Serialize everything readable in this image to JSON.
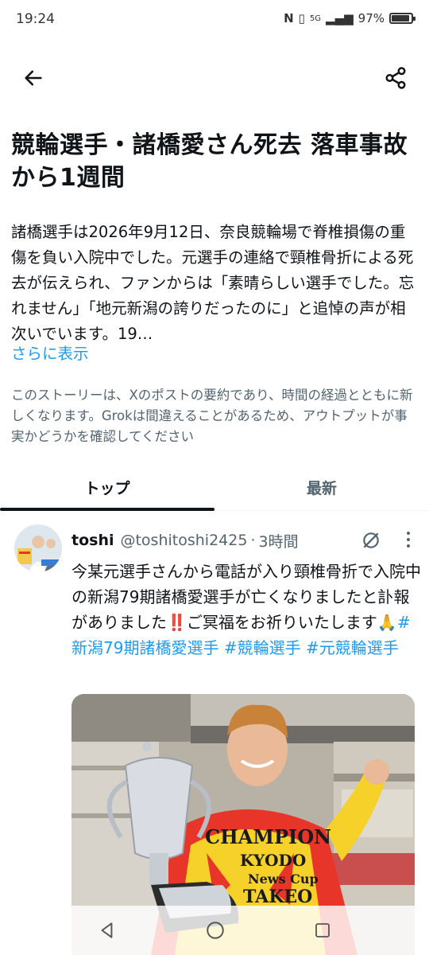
{
  "status_bar": {
    "time": "19:24",
    "network": "5G",
    "battery_text": "97%"
  },
  "nav": {
    "back_icon": "arrow-left-icon",
    "share_icon": "share-icon"
  },
  "story": {
    "title": "競輪選手・諸橋愛さん死去 落車事故から1週間",
    "body": "諸橋選手は2026年9月12日、奈良競輪場で脊椎損傷の重傷を負い入院中でした。元選手の連絡で頸椎骨折による死去が伝えられ、ファンからは「素晴らしい選手でした。忘れません」「地元新潟の誇りだったのに」と追悼の声が相次いでいます。19…",
    "show_more": "さらに表示",
    "disclaimer": "このストーリーは、Xのポストの要約であり、時間の経過とともに新しくなります。Grokは間違えることがあるため、アウトプットが事実かどうかを確認してください"
  },
  "tabs": [
    {
      "label": "トップ",
      "active": true
    },
    {
      "label": "最新",
      "active": false
    }
  ],
  "post": {
    "author": "toshi",
    "handle": "@toshitoshi2425",
    "separator": "·",
    "time": "3時間",
    "text": "今某元選手さんから電話が入り頸椎骨折で入院中の新潟79期諸橋愛選手が亡くなりましたと訃報がありました‼️ご冥福をお祈りいたします🙏",
    "hashtags": [
      "#新潟79期諸橋愛選手",
      "#競輪選手",
      "#元競輪選手"
    ],
    "jersey_text": [
      "CHAMPION",
      "KYODO",
      "News Cup",
      "TAKEO"
    ],
    "grok_icon": "grok-icon",
    "more_icon": "more-vertical-icon"
  },
  "system_nav": {
    "back": "triangle-back-icon",
    "home": "circle-home-icon",
    "recents": "square-recents-icon"
  },
  "colors": {
    "accent": "#1d9bf0",
    "text_primary": "#0f1419",
    "text_secondary": "#536471",
    "jersey_red": "#e8352a",
    "jersey_yellow": "#f5d12a"
  }
}
